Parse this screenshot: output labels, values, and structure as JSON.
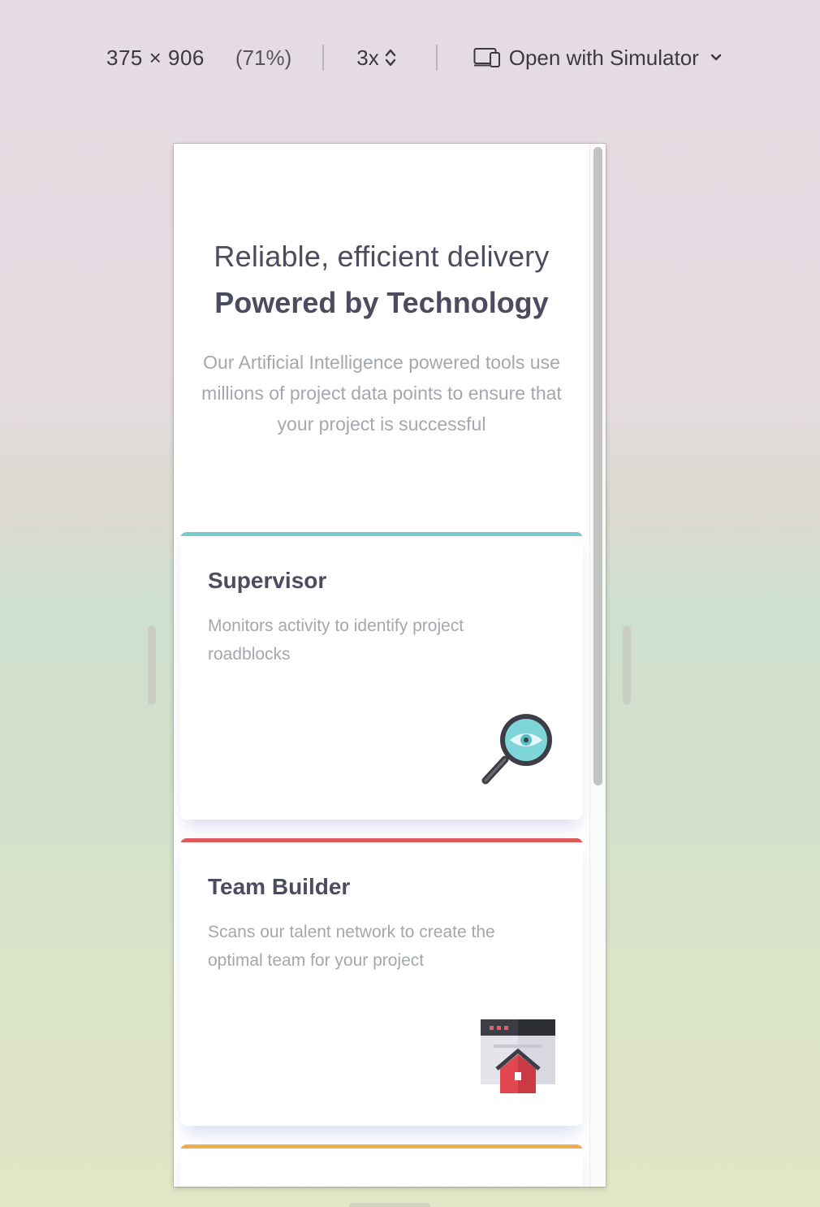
{
  "toolbar": {
    "dimensions": "375  ×  906",
    "zoom": "(71%)",
    "scale": "3x",
    "open_with": "Open with Simulator"
  },
  "hero": {
    "line1": "Reliable, efficient delivery",
    "line2": "Powered by Technology",
    "description": "Our Artificial Intelligence powered tools use millions of project data points to ensure that your project is successful"
  },
  "cards": [
    {
      "title": "Supervisor",
      "description": "Monitors activity to identify project roadblocks",
      "accent": "#44d3d2",
      "icon": "magnifier-eye-icon"
    },
    {
      "title": "Team Builder",
      "description": "Scans our talent network to create the optimal team for your project",
      "accent": "#ea5454",
      "icon": "team-builder-icon"
    },
    {
      "title": "",
      "description": "",
      "accent": "#fcaf4a",
      "icon": ""
    }
  ]
}
